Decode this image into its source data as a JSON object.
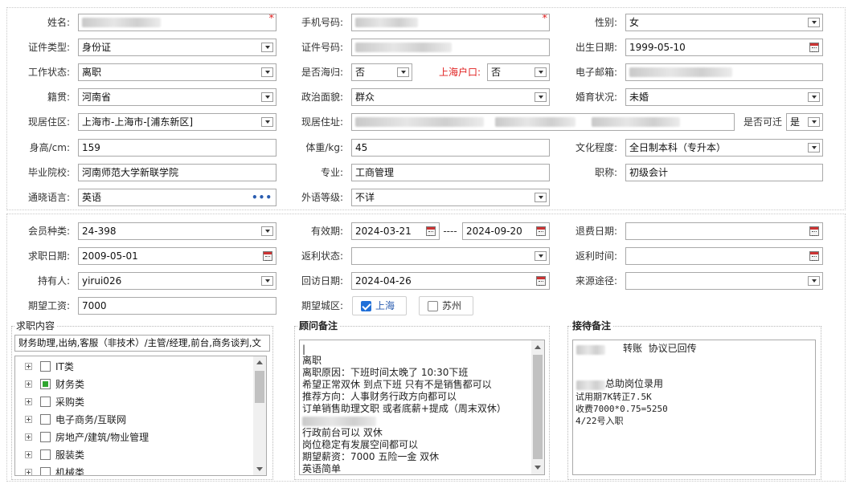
{
  "personal": {
    "name_label": "姓名:",
    "phone_label": "手机号码:",
    "required_mark": "*",
    "gender_label": "性别:",
    "gender_value": "女",
    "id_type_label": "证件类型:",
    "id_type_value": "身份证",
    "id_no_label": "证件号码:",
    "birth_label": "出生日期:",
    "birth_value": "1999-05-10",
    "work_status_label": "工作状态:",
    "work_status_value": "离职",
    "returnee_label": "是否海归:",
    "returnee_value": "否",
    "shanghai_hukou_label": "上海户口:",
    "shanghai_hukou_value": "否",
    "email_label": "电子邮箱:",
    "native_label": "籍贯:",
    "native_value": "河南省",
    "political_label": "政治面貌:",
    "political_value": "群众",
    "marital_label": "婚育状况:",
    "marital_value": "未婚",
    "region_label": "现居住区:",
    "region_value": "上海市-上海市-[浦东新区]",
    "address_label": "现居住址:",
    "movable_label": "是否可迁",
    "movable_value": "是",
    "height_label": "身高/cm:",
    "height_value": "159",
    "weight_label": "体重/kg:",
    "weight_value": "45",
    "education_label": "文化程度:",
    "education_value": "全日制本科（专升本）",
    "school_label": "毕业院校:",
    "school_value": "河南师范大学新联学院",
    "major_label": "专业:",
    "major_value": "工商管理",
    "title_label": "职称:",
    "title_value": "初级会计",
    "language_label": "通晓语言:",
    "language_value": "英语",
    "more_icon": "•••",
    "foreign_level_label": "外语等级:",
    "foreign_level_value": "不详"
  },
  "membership": {
    "member_type_label": "会员种类:",
    "member_type_value": "24-398",
    "valid_label": "有效期:",
    "valid_from": "2024-03-21",
    "valid_sep": "----",
    "valid_to": "2024-09-20",
    "refund_date_label": "退费日期:",
    "job_date_label": "求职日期:",
    "job_date_value": "2009-05-01",
    "rebate_status_label": "返利状态:",
    "rebate_time_label": "返利时间:",
    "holder_label": "持有人:",
    "holder_value": "yirui026",
    "visit_date_label": "回访日期:",
    "visit_date_value": "2024-04-26",
    "source_label": "来源途径:",
    "salary_label": "期望工资:",
    "salary_value": "7000",
    "city_label": "期望城区:",
    "city_shanghai": "上海",
    "city_suzhou": "苏州"
  },
  "job_content": {
    "title": "求职内容",
    "summary": "财务助理,出纳,客服（非技术）/主管/经理,前台,商务谈判,文",
    "tree": [
      "IT类",
      "财务类",
      "采购类",
      "电子商务/互联网",
      "房地产/建筑/物业管理",
      "服装类",
      "机械类"
    ]
  },
  "advisor_notes": {
    "title": "顾问备注",
    "lines": [
      "离职",
      "离职原因：下班时间太晚了 10:30下班",
      "希望正常双休 到点下班 只有不是销售都可以",
      "推荐方向：人事财务行政方向都可以",
      "订单销售助理文职 或者底薪+提成（周末双休）",
      "行政前台可以 双休",
      "岗位稳定有发展空间都可以",
      "期望薪资：7000 五险一金 双休",
      "英语简单"
    ]
  },
  "reception_notes": {
    "title": "接待备注",
    "line1": "转账  协议已回传",
    "line2": "总助岗位录用",
    "line3": "试用期7K转正7.5K",
    "line4": "收费7000*0.75=5250",
    "line5": "4/22号入职"
  }
}
